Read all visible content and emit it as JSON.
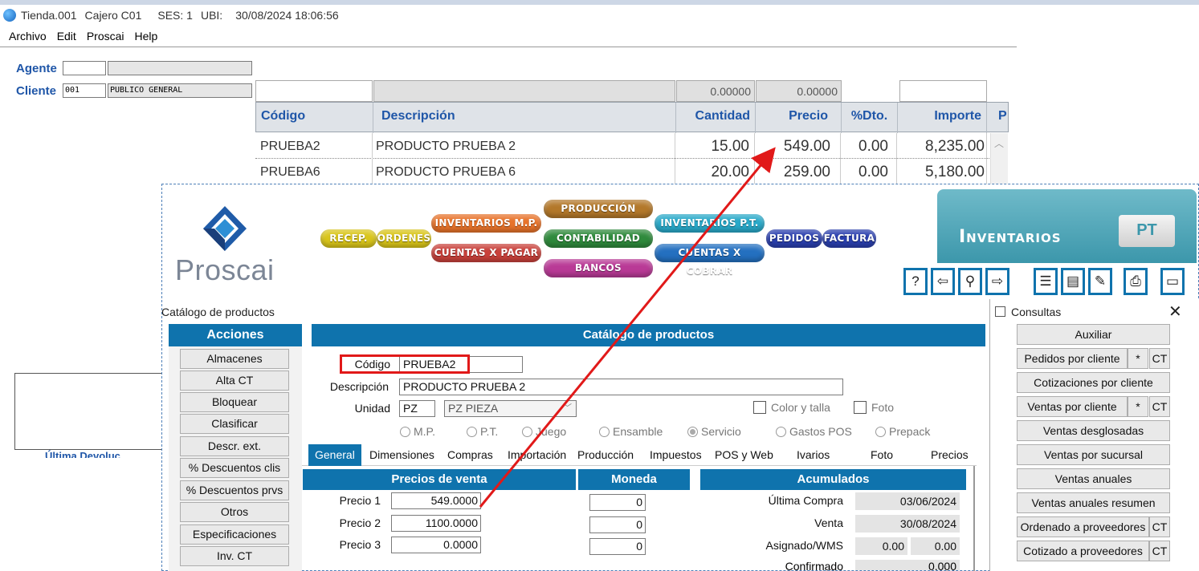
{
  "titlebar": {
    "store": "Tienda.001",
    "cashier": "Cajero C01",
    "session": "SES: 1",
    "ubi": "UBI:",
    "datetime": "30/08/2024 18:06:56"
  },
  "menu": [
    "Archivo",
    "Edit",
    "Proscai",
    "Help"
  ],
  "header_form": {
    "agente_label": "Agente",
    "cliente_label": "Cliente",
    "cliente_code": "001",
    "cliente_name": "PUBLICO GENERAL"
  },
  "top_grid": {
    "entry_cantidad": "0.00000",
    "entry_precio": "0.00000",
    "columns": [
      "Código",
      "Descripción",
      "Cantidad",
      "Precio",
      "%Dto.",
      "Importe",
      "P"
    ],
    "rows": [
      {
        "codigo": "PRUEBA2",
        "descripcion": "PRODUCTO PRUEBA 2",
        "cantidad": "15.00",
        "precio": "549.00",
        "dto": "0.00",
        "importe": "8,235.00"
      },
      {
        "codigo": "PRUEBA6",
        "descripcion": "PRODUCTO PRUEBA 6",
        "cantidad": "20.00",
        "precio": "259.00",
        "dto": "0.00",
        "importe": "5,180.00"
      }
    ]
  },
  "logo": {
    "text": "Proscai"
  },
  "module_pills": {
    "recep": "RECEP.",
    "ordenes": "ORDENES",
    "inventarios_mp": "INVENTARIOS M.P.",
    "cuentas_pagar": "CUENTAS X PAGAR",
    "produccion": "PRODUCCIÓN",
    "contabilidad": "CONTABILIDAD",
    "bancos": "BANCOS",
    "inventarios_pt": "INVENTARIOS P.T.",
    "cuentas_cobrar": "CUENTAS X COBRAR",
    "pedidos": "PEDIDOS",
    "factura": "FACTURA"
  },
  "module_banner": {
    "title": "Inventarios",
    "tag": "PT"
  },
  "window": {
    "title": "Catálogo de productos"
  },
  "acciones": {
    "title": "Acciones",
    "buttons": [
      "Almacenes",
      "Alta CT",
      "Bloquear",
      "Clasificar",
      "Descr. ext.",
      "% Descuentos clis",
      "% Descuentos prvs",
      "Otros",
      "Especificaciones",
      "Inv. CT"
    ]
  },
  "catalogo": {
    "title": "Catálogo de productos",
    "codigo_label": "Código",
    "codigo_value": "PRUEBA2",
    "descripcion_label": "Descripción",
    "descripcion_value": "PRODUCTO PRUEBA 2",
    "unidad_label": "Unidad",
    "unidad_code": "PZ",
    "unidad_name": "PZ  PIEZA",
    "color_talla": "Color y talla",
    "foto": "Foto",
    "tipos": [
      "M.P.",
      "P.T.",
      "Juego",
      "Ensamble",
      "Servicio",
      "Gastos POS",
      "Prepack"
    ],
    "tipo_selected": "Servicio"
  },
  "tabs": [
    "General",
    "Dimensiones",
    "Compras",
    "Importación",
    "Producción",
    "Impuestos",
    "POS y Web",
    "Ivarios",
    "Foto",
    "Precios"
  ],
  "precios": {
    "title": "Precios de venta",
    "items": [
      {
        "label": "Precio 1",
        "value": "549.0000",
        "moneda": "0"
      },
      {
        "label": "Precio 2",
        "value": "1100.0000",
        "moneda": "0"
      },
      {
        "label": "Precio 3",
        "value": "0.0000",
        "moneda": "0"
      }
    ]
  },
  "moneda": {
    "title": "Moneda"
  },
  "acumulados": {
    "title": "Acumulados",
    "ultima_compra_label": "Última  Compra",
    "ultima_compra": "03/06/2024",
    "venta_label": "Venta",
    "venta": "30/08/2024",
    "asignado_label": "Asignado/WMS",
    "asignado_1": "0.00",
    "asignado_2": "0.00",
    "confirmado_label": "Confirmado",
    "confirmado": "0.000"
  },
  "consultas": {
    "title": "Consultas",
    "close": "✕",
    "auxiliar": "Auxiliar",
    "pedidos_cliente": "Pedidos por cliente",
    "cotizaciones_cliente": "Cotizaciones por cliente",
    "ventas_cliente": "Ventas por cliente",
    "star": "*",
    "ct": "CT",
    "ventas_desglosadas": "Ventas desglosadas",
    "ventas_sucursal": "Ventas por sucursal",
    "ventas_anuales": "Ventas anuales",
    "ventas_anuales_resumen": "Ventas anuales resumen",
    "ordenado_proveedores": "Ordenado a proveedores",
    "cotizado_proveedores": "Cotizado a proveedores"
  },
  "background_fragment": "Última  Devoluc"
}
